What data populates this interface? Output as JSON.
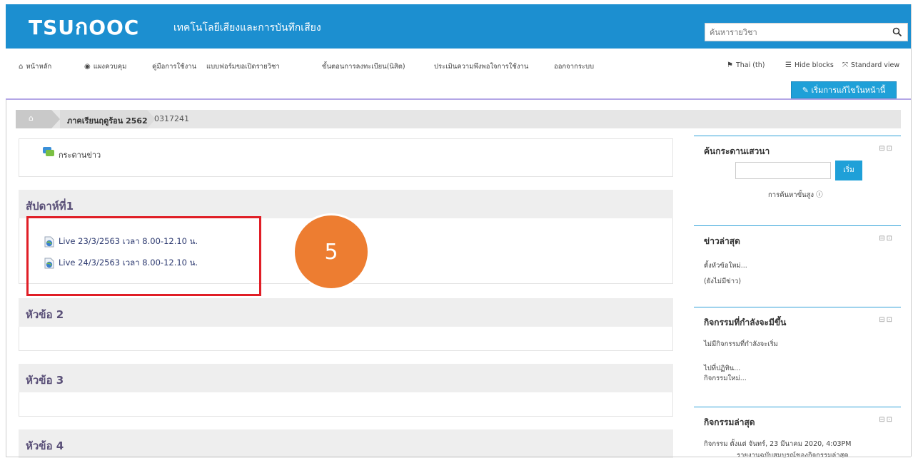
{
  "header": {
    "logo": "TSUปOOC",
    "site_title": "เทคโนโลยีเสียงและการบันทึกเสียง",
    "search_placeholder": "ค้นหารายวิชา"
  },
  "nav": {
    "items": [
      {
        "label": "หน้าหลัก",
        "icon": "home-icon"
      },
      {
        "label": "แผงควบคุม",
        "icon": "dashboard-icon"
      },
      {
        "label": "คู่มือการใช้งาน"
      },
      {
        "label": "แบบฟอร์มขอเปิดรายวิชา"
      },
      {
        "label": "ขั้นตอนการลงทะเบียน(นิสิต)"
      },
      {
        "label": "ประเมินความพึงพอใจการใช้งาน"
      },
      {
        "label": "ออกจากระบบ"
      }
    ],
    "lang": "Thai (th)",
    "hide_blocks": "Hide blocks",
    "standard_view": "Standard view",
    "edit_button": "เริ่มการแก้ไขในหน้านี้"
  },
  "breadcrumb": {
    "term": "ภาคเรียนฤดูร้อน 2562",
    "course": "0317241"
  },
  "main": {
    "forum": "กระดานข่าว",
    "sections": [
      {
        "title": "สัปดาห์ที่1",
        "items": [
          "Live 23/3/2563 เวลา 8.00-12.10 น.",
          "Live 24/3/2563 เวลา 8.00-12.10 น."
        ]
      },
      {
        "title": "หัวข้อ 2"
      },
      {
        "title": "หัวข้อ 3"
      },
      {
        "title": "หัวข้อ 4"
      }
    ],
    "badge_number": "5"
  },
  "sidebar": {
    "search_forum": {
      "title": "ค้นกระดานเสวนา",
      "go": "เริ่ม",
      "advanced": "การค้นหาขั้นสูง"
    },
    "news": {
      "title": "ข่าวล่าสุด",
      "add": "ตั้งหัวข้อใหม่...",
      "empty": "(ยังไม่มีข่าว)"
    },
    "upcoming": {
      "title": "กิจกรรมที่กำลังจะมีขึ้น",
      "none": "ไม่มีกิจกรรมที่กำลังจะเริ่ม",
      "calendar": "ไปที่ปฏิทิน...",
      "new_event": "กิจกรรมใหม่..."
    },
    "recent": {
      "title": "กิจกรรมล่าสุด",
      "since": "กิจกรรม ตั้งแต่ จันทร์, 23 มีนาคม 2020, 4:03PM",
      "report": "รายงานฉบับสมบูรณ์ของกิจกรรมล่าสุด"
    },
    "block_controls": "⊟⊡"
  },
  "colors": {
    "header_bg": "#1c8fd0",
    "accent": "#1fa0d8",
    "highlight_box": "#e01e26",
    "badge": "#ed7d31"
  }
}
